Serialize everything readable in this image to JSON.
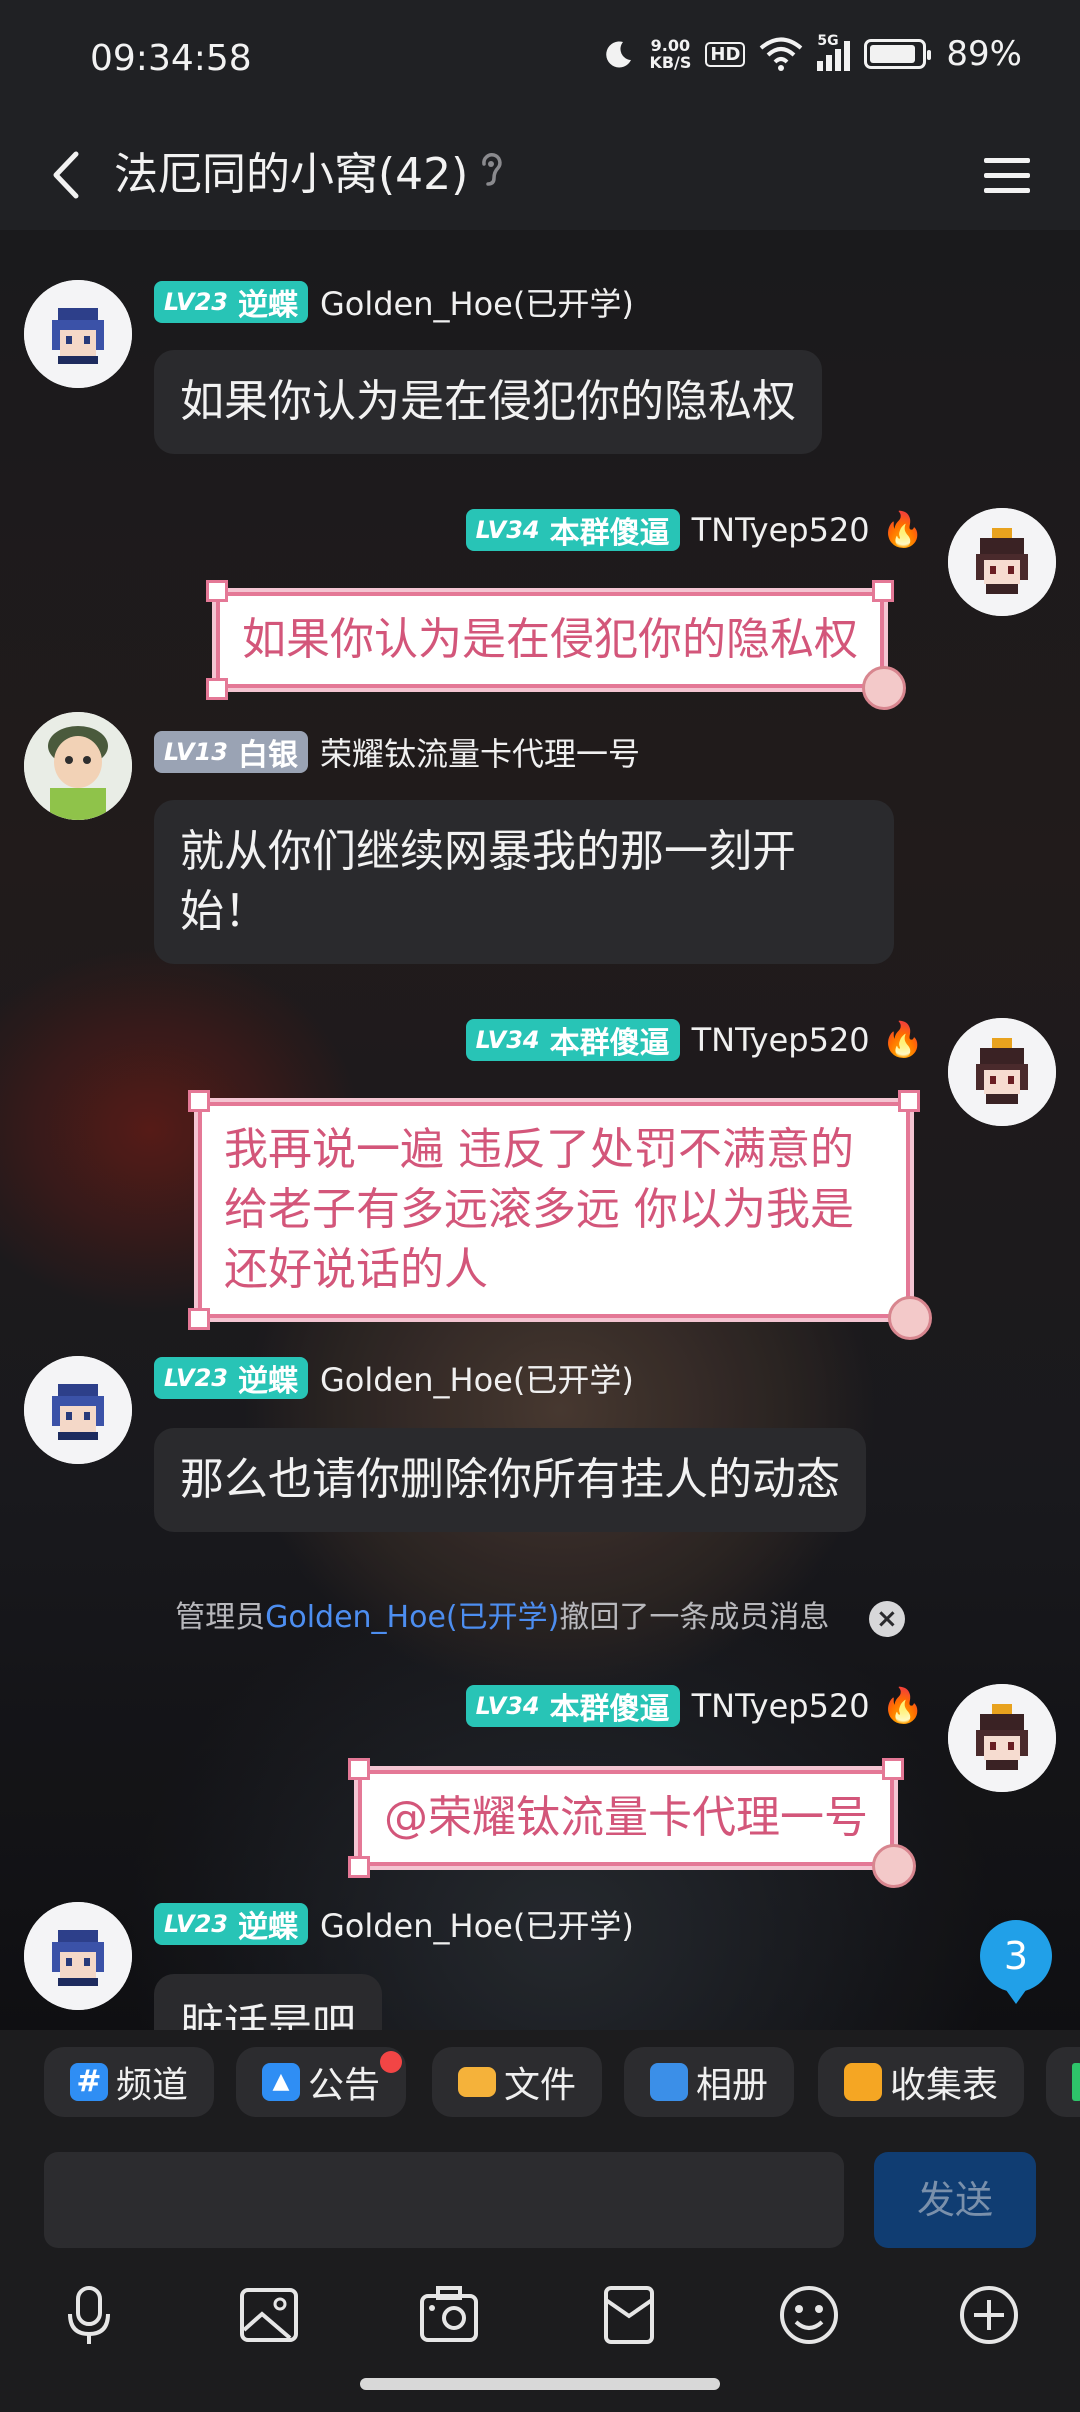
{
  "status_bar": {
    "time": "09:34:58",
    "net_speed_value": "9.00",
    "net_speed_unit": "KB/S",
    "hd_label": "HD",
    "signal_label": "5G",
    "battery": "89%"
  },
  "header": {
    "title": "法厄同的小窝(42)"
  },
  "messages": [
    {
      "level": "LV23",
      "title": "逆蝶",
      "name": "Golden_Hoe(已开学)",
      "text": "如果你认为是在侵犯你的隐私权"
    },
    {
      "level": "LV34",
      "title": "本群傻逼",
      "name": "TNTyep520",
      "text": "如果你认为是在侵犯你的隐私权"
    },
    {
      "level": "LV13",
      "title": "白银",
      "name": "荣耀钛流量卡代理一号",
      "text_line1": "就从你们继续网暴我的那一刻开",
      "text_line2": "始！"
    },
    {
      "level": "LV34",
      "title": "本群傻逼",
      "name": "TNTyep520",
      "text_line1": "我再说一遍 违反了处罚不满意的",
      "text_line2": "给老子有多远滚多远 你以为我是",
      "text_line3": "还好说话的人"
    },
    {
      "level": "LV23",
      "title": "逆蝶",
      "name": "Golden_Hoe(已开学)",
      "text": "那么也请你删除你所有挂人的动态"
    },
    {
      "level": "LV34",
      "title": "本群傻逼",
      "name": "TNTyep520",
      "text": "@荣耀钛流量卡代理一号"
    },
    {
      "level": "LV23",
      "title": "逆蝶",
      "name": "Golden_Hoe(已开学)",
      "text": "脏话是吧"
    }
  ],
  "system_notice": {
    "prefix": "管理员",
    "link": "Golden_Hoe(已开学)",
    "suffix": "撤回了一条成员消息"
  },
  "unread_count": "3",
  "toolbar": {
    "items": [
      {
        "label": "频道",
        "icon": "hash-icon"
      },
      {
        "label": "公告",
        "icon": "announcement-icon"
      },
      {
        "label": "文件",
        "icon": "folder-icon"
      },
      {
        "label": "相册",
        "icon": "album-icon"
      },
      {
        "label": "收集表",
        "icon": "clipboard-icon"
      }
    ]
  },
  "composer": {
    "send_label": "发送"
  },
  "bottom_icons": [
    "microphone-icon",
    "image-icon",
    "camera-icon",
    "red-packet-icon",
    "emoji-icon",
    "plus-icon"
  ],
  "colors": {
    "level_teal": "#28c4b6",
    "level_silver": "#9aa3b4",
    "pink_border": "#e47896",
    "pink_text": "#d3567a",
    "link_blue": "#4d8ef0",
    "unread_blue": "#21a0e8"
  }
}
